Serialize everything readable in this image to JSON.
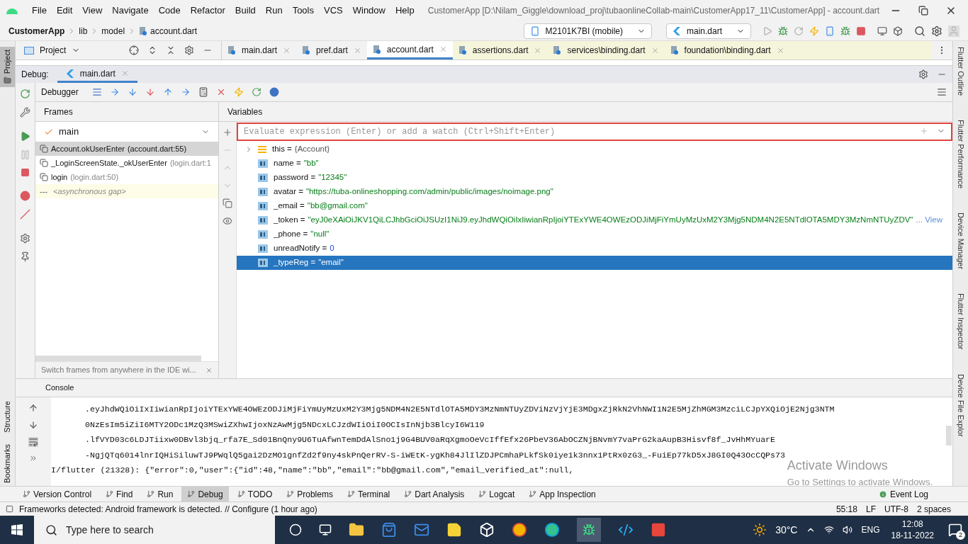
{
  "menu": [
    "File",
    "Edit",
    "View",
    "Navigate",
    "Code",
    "Refactor",
    "Build",
    "Run",
    "Tools",
    "VCS",
    "Window",
    "Help"
  ],
  "title": "CustomerApp [D:\\Nilam_Giggle\\download_proj\\tubaonlineCollab-main\\CustomerApp17_11\\CustomerApp] - account.dart",
  "breadcrumb": [
    "CustomerApp",
    "lib",
    "model",
    "account.dart"
  ],
  "device": "M2101K7BI (mobile)",
  "run_config": "main.dart",
  "project_panel": "Project",
  "editor_tabs": [
    {
      "label": "main.dart",
      "selected": false,
      "kind": "project"
    },
    {
      "label": "pref.dart",
      "selected": false,
      "kind": "project"
    },
    {
      "label": "account.dart",
      "selected": true,
      "kind": "project"
    },
    {
      "label": "assertions.dart",
      "selected": false,
      "kind": "library"
    },
    {
      "label": "services\\binding.dart",
      "selected": false,
      "kind": "library"
    },
    {
      "label": "foundation\\binding.dart",
      "selected": false,
      "kind": "library"
    }
  ],
  "debug": {
    "label": "Debug:",
    "tab": "main.dart",
    "toolbar_label": "Debugger"
  },
  "frames": {
    "title": "Frames",
    "thread": "main",
    "items": [
      {
        "kind": "frame",
        "name": "Account.okUserEnter",
        "location": "(account.dart:55)",
        "selected": true
      },
      {
        "kind": "frame",
        "name": "_LoginScreenState._okUserEnter",
        "location": "(login.dart:1",
        "selected": false
      },
      {
        "kind": "frame",
        "name": "login",
        "location": "(login.dart:50)",
        "selected": false
      },
      {
        "kind": "gap",
        "name": "---",
        "location": "<asynchronous gap>",
        "selected": false
      }
    ],
    "hint": "Switch frames from anywhere in the IDE wi..."
  },
  "variables": {
    "title": "Variables",
    "placeholder": "Evaluate expression (Enter) or add a watch (Ctrl+Shift+Enter)",
    "items": [
      {
        "kind": "object",
        "name": "this =",
        "value": "{Account}",
        "selected": false
      },
      {
        "kind": "string",
        "name": "name =",
        "value": "\"bb\"",
        "selected": false
      },
      {
        "kind": "string",
        "name": "password =",
        "value": "\"12345\"",
        "selected": false
      },
      {
        "kind": "string",
        "name": "avatar =",
        "value": "\"https://tuba-onlineshopping.com/admin/public/images/noimage.png\"",
        "selected": false
      },
      {
        "kind": "string",
        "name": "_email =",
        "value": "\"bb@gmail.com\"",
        "selected": false
      },
      {
        "kind": "string",
        "name": "_token =",
        "value": "\"eyJ0eXAiOiJKV1QiLCJhbGciOiJSUzI1NiJ9.eyJhdWQiOiIxIiwianRpIjoiYTExYWE4OWEzODJiMjFiYmUyMzUxM2Y3Mjg5NDM4N2E5NTdlOTA5MDY3MzNmNTUyZDV\"",
        "more": "... View",
        "selected": false
      },
      {
        "kind": "string",
        "name": "_phone =",
        "value": "\"null\"",
        "selected": false
      },
      {
        "kind": "number",
        "name": "unreadNotify =",
        "value": "0",
        "selected": false
      },
      {
        "kind": "string",
        "name": "_typeReg =",
        "value": "\"email\"",
        "selected": true
      }
    ]
  },
  "console": {
    "title": "Console",
    "lines": [
      ".eyJhdWQiOiIxIiwianRpIjoiYTExYWE4OWEzODJiMjFiYmUyMzUxM2Y3Mjg5NDM4N2E5NTdlOTA5MDY3MzNmNTUyZDViNzVjYjE3MDgxZjRkN2VhNWI1N2E5MjZhMGM3MzciLCJpYXQiOjE2Njg3NTM",
      "0NzEsIm5iZiI6MTY2ODc1MzQ3MSwiZXhwIjoxNzAwMjg5NDcxLCJzdWIiOiI0OCIsInNjb3BlcyI6W119",
      ".lfVYD03c6LDJTiixw0DBvl3bjq_rfa7E_Sd01BnQny9U6TuAfwnTemDdAlSno1j9G4BUV0aRqXgmoOeVcIffEfx26PbeV36AbOCZNjBNvmY7vaPrG2kaAupB3Hisvf8f_JvHhMYuarE",
      "-NgjQTq6014lnrIQHiSiluwTJ9PWqlQ5gai2DzMO1gnfZd2f9ny4skPnQerRV-S-iWEtK-ygKh84JlIlZDJPCmhaPLkfSk0iye1k3nnx1PtRx0zG3_-FuiEp77kD5xJ8GI0Q43OcCQPs73",
      "I/flutter (21328): {\"error\":0,\"user\":{\"id\":48,\"name\":\"bb\",\"email\":\"bb@gmail.com\",\"email_verified_at\":null,"
    ]
  },
  "tool_windows": [
    {
      "label": "Version Control",
      "selected": false
    },
    {
      "label": "Find",
      "selected": false
    },
    {
      "label": "Run",
      "selected": false
    },
    {
      "label": "Debug",
      "selected": true
    },
    {
      "label": "TODO",
      "selected": false
    },
    {
      "label": "Problems",
      "selected": false
    },
    {
      "label": "Terminal",
      "selected": false
    },
    {
      "label": "Dart Analysis",
      "selected": false
    },
    {
      "label": "Logcat",
      "selected": false
    },
    {
      "label": "App Inspection",
      "selected": false
    }
  ],
  "event_log": "Event Log",
  "status": {
    "message": "Frameworks detected: Android framework is detected. // Configure (1 hour ago)",
    "items": [
      "55:18",
      "LF",
      "UTF-8",
      "2 spaces"
    ]
  },
  "left_strip": [
    "Project",
    "Structure",
    "Bookmarks"
  ],
  "right_strip": [
    "Flutter Outline",
    "Flutter Performance",
    "Device Manager",
    "Flutter Inspector",
    "Device File Explor"
  ],
  "activation": {
    "title": "Activate Windows",
    "subtitle": "Go to Settings to activate Windows."
  },
  "taskbar": {
    "search_placeholder": "Type here to search",
    "temperature": "30°C",
    "language": "ENG",
    "time": "12:08",
    "date": "18-11-2022",
    "notifications": "2"
  }
}
